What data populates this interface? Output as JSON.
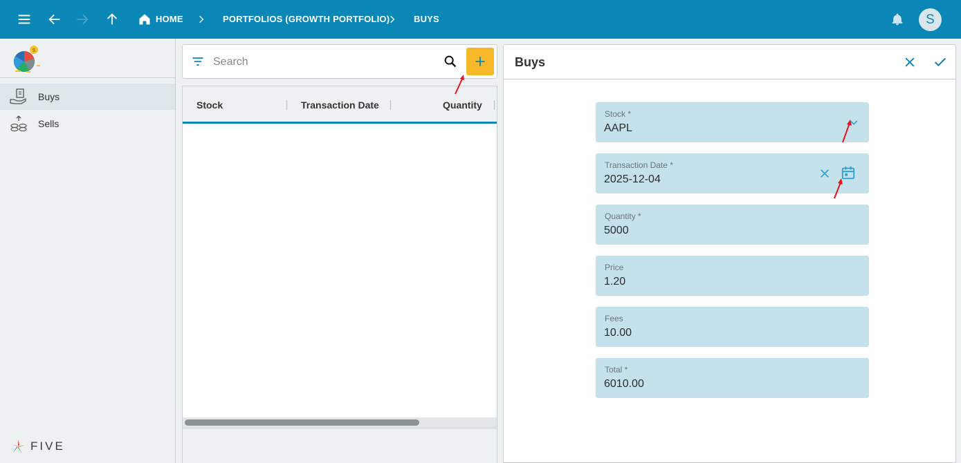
{
  "topbar": {
    "breadcrumbs": [
      {
        "label": "HOME"
      },
      {
        "label": "PORTFOLIOS (GROWTH PORTFOLIO)"
      },
      {
        "label": "BUYS"
      }
    ],
    "avatar_initial": "S"
  },
  "sidebar": {
    "items": [
      {
        "label": "Buys",
        "icon": "hand-money-icon",
        "active": true
      },
      {
        "label": "Sells",
        "icon": "coins-icon",
        "active": false
      }
    ],
    "footer_logo_text": "FIVE"
  },
  "list": {
    "search_placeholder": "Search",
    "columns": [
      "Stock",
      "Transaction Date",
      "Quantity"
    ]
  },
  "form": {
    "title": "Buys",
    "fields": [
      {
        "label": "Stock *",
        "value": "AAPL"
      },
      {
        "label": "Transaction Date *",
        "value": "2025-12-04"
      },
      {
        "label": "Quantity *",
        "value": "5000"
      },
      {
        "label": "Price",
        "value": "1.20"
      },
      {
        "label": "Fees",
        "value": "10.00"
      },
      {
        "label": "Total *",
        "value": "6010.00"
      }
    ]
  },
  "colors": {
    "topbar": "#0b87b7",
    "accent_button": "#f6b729",
    "field_bg": "#c4e1ec",
    "annotation_arrow": "#e8141a"
  }
}
